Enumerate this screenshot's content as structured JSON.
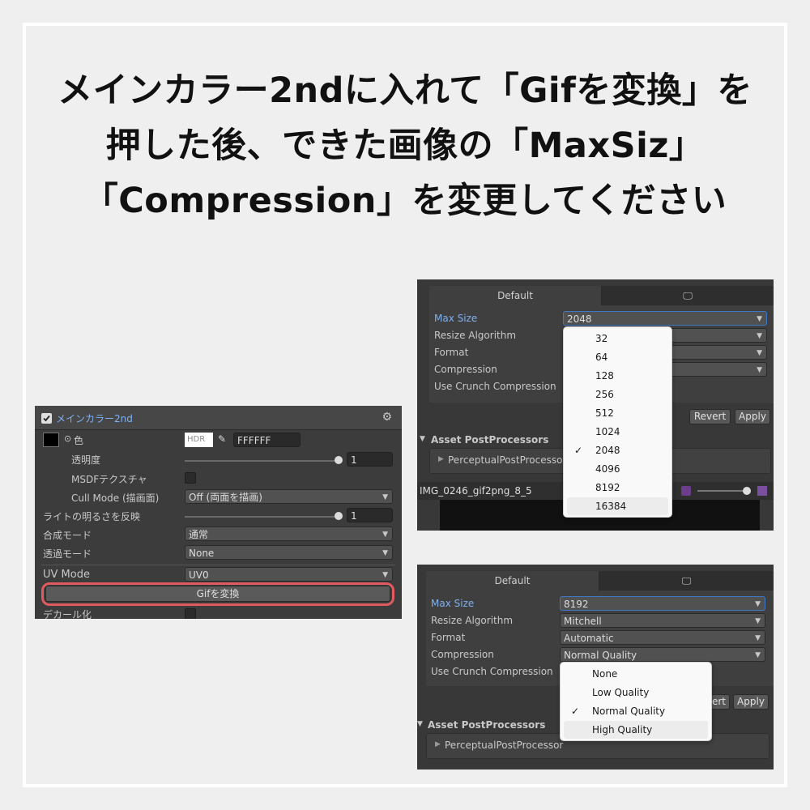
{
  "heading": {
    "line1": "メインカラー2ndに入れて「Gifを変換」を",
    "line2": "押した後、できた画像の「MaxSiz」",
    "line3": "「Compression」を変更してください"
  },
  "left_panel": {
    "title": "メインカラー2nd",
    "color_label": "色",
    "hdr_label": "HDR",
    "hex_value": "FFFFFF",
    "transparency_label": "透明度",
    "transparency_value": "1",
    "msdf_label": "MSDFテクスチャ",
    "cull_label": "Cull Mode (描画面)",
    "cull_value": "Off (両面を描画)",
    "light_label": "ライトの明るさを反映",
    "light_value": "1",
    "blend_label": "合成モード",
    "blend_value": "通常",
    "alpha_label": "透過モード",
    "alpha_value": "None",
    "uv_label": "UV Mode",
    "uv_value": "UV0",
    "gif_button": "Gifを変換",
    "decal_label": "デカール化",
    "highlight_color": "#e05a5f"
  },
  "panel_a": {
    "tab_default": "Default",
    "maxsize_label": "Max Size",
    "maxsize_value": "2048",
    "resize_label": "Resize Algorithm",
    "format_label": "Format",
    "compression_label": "Compression",
    "crunch_label": "Use Crunch Compression",
    "revert": "Revert",
    "apply": "Apply",
    "postproc_label": "Asset PostProcessors",
    "postproc_item": "PerceptualPostProcesso",
    "asset_name": "IMG_0246_gif2png_8_5",
    "menu_options": [
      "32",
      "64",
      "128",
      "256",
      "512",
      "1024",
      "2048",
      "4096",
      "8192",
      "16384"
    ],
    "menu_checked": "2048",
    "checkmark": "✓"
  },
  "panel_b": {
    "tab_default": "Default",
    "maxsize_label": "Max Size",
    "maxsize_value": "8192",
    "resize_label": "Resize Algorithm",
    "resize_value": "Mitchell",
    "format_label": "Format",
    "format_value": "Automatic",
    "compression_label": "Compression",
    "compression_value": "Normal Quality",
    "crunch_label": "Use Crunch Compression",
    "revert_partial": "ert",
    "apply": "Apply",
    "postproc_label": "Asset PostProcessors",
    "postproc_item": "PerceptualPostProcessor",
    "menu_options": [
      "None",
      "Low Quality",
      "Normal Quality",
      "High Quality"
    ],
    "menu_checked": "Normal Quality",
    "checkmark": "✓"
  }
}
